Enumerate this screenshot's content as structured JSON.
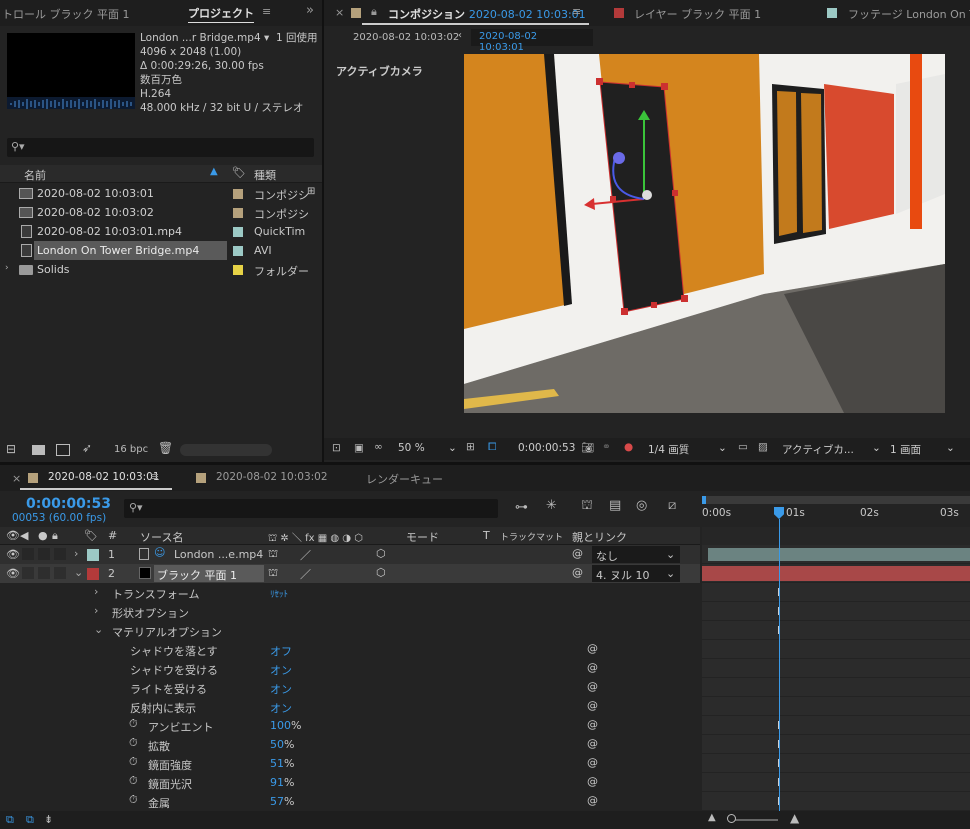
{
  "project_panel": {
    "tab_left": "トロール ブラック 平面 1",
    "tab_active": "プロジェクト",
    "preview": {
      "name": "London ...r Bridge.mp4 ▾",
      "usage": "1 回使用",
      "dims": "4096 x 2048 (1.00)",
      "duration": "Δ 0:00:29:26, 30.00 fps",
      "colors": "数百万色",
      "codec": "H.264",
      "audio": "48.000 kHz / 32 bit U / ステレオ"
    },
    "search_placeholder": "",
    "col_name": "名前",
    "col_type": "種類",
    "items": [
      {
        "name": "2020-08-02 10:03:01",
        "type": "コンポジシ",
        "color": "#b5a17c",
        "icon": "composition-icon"
      },
      {
        "name": "2020-08-02 10:03:02",
        "type": "コンポジシ",
        "color": "#b5a17c",
        "icon": "composition-icon"
      },
      {
        "name": "2020-08-02 10:03:01.mp4",
        "type": "QuickTim",
        "color": "#9cc9c5",
        "icon": "footage-icon"
      },
      {
        "name": "London On Tower Bridge.mp4",
        "type": "AVI",
        "color": "#9cc9c5",
        "icon": "footage-icon"
      },
      {
        "name": "Solids",
        "type": "フォルダー",
        "color": "#e6d246",
        "icon": "folder-icon"
      }
    ],
    "bpc": "16 bpc"
  },
  "viewer": {
    "tab_comp_label": "コンポジション",
    "tab_comp_name": "2020-08-02 10:03:01",
    "tab_layer": "レイヤー ブラック 平面 1",
    "tab_footage": "フッテージ London On To",
    "crumb_1": "2020-08-02 10:03:02",
    "crumb_2": "2020-08-02 10:03:01",
    "camera_label": "アクティブカメラ",
    "zoom": "50 %",
    "timecode": "0:00:00:53",
    "resolution": "1/4 画質",
    "camera_select": "アクティブカ...",
    "views_select": "1 画面"
  },
  "timeline": {
    "tab_1": "2020-08-02 10:03:01",
    "tab_2": "2020-08-02 10:03:02",
    "tab_3": "レンダーキュー",
    "timecode": "0:00:00:53",
    "frames": "00053 (60.00 fps)",
    "col_source": "ソース名",
    "col_mode": "モード",
    "col_t": "T",
    "col_trackmatte": "トラックマット",
    "col_parent": "親とリンク",
    "ruler": [
      "0:00s",
      "01s",
      "02s",
      "03s"
    ],
    "layers": [
      {
        "num": "1",
        "name": "London ...e.mp4",
        "color": "#9cc9c5",
        "parent": "なし"
      },
      {
        "num": "2",
        "name": "ブラック 平面 1",
        "color": "#b33a3a",
        "parent": "4. ヌル 10"
      }
    ],
    "transform": "トランスフォーム",
    "reset": "ﾘｾｯﾄ",
    "shape_options": "形状オプション",
    "material_options": "マテリアルオプション",
    "props": [
      {
        "name": "シャドウを落とす",
        "value": "オフ",
        "unit": ""
      },
      {
        "name": "シャドウを受ける",
        "value": "オン",
        "unit": ""
      },
      {
        "name": "ライトを受ける",
        "value": "オン",
        "unit": ""
      },
      {
        "name": "反射内に表示",
        "value": "オン",
        "unit": ""
      },
      {
        "name": "アンビエント",
        "value": "100",
        "unit": "%"
      },
      {
        "name": "拡散",
        "value": "50",
        "unit": "%"
      },
      {
        "name": "鏡面強度",
        "value": "51",
        "unit": "%"
      },
      {
        "name": "鏡面光沢",
        "value": "91",
        "unit": "%"
      },
      {
        "name": "金属",
        "value": "57",
        "unit": "%"
      }
    ]
  }
}
